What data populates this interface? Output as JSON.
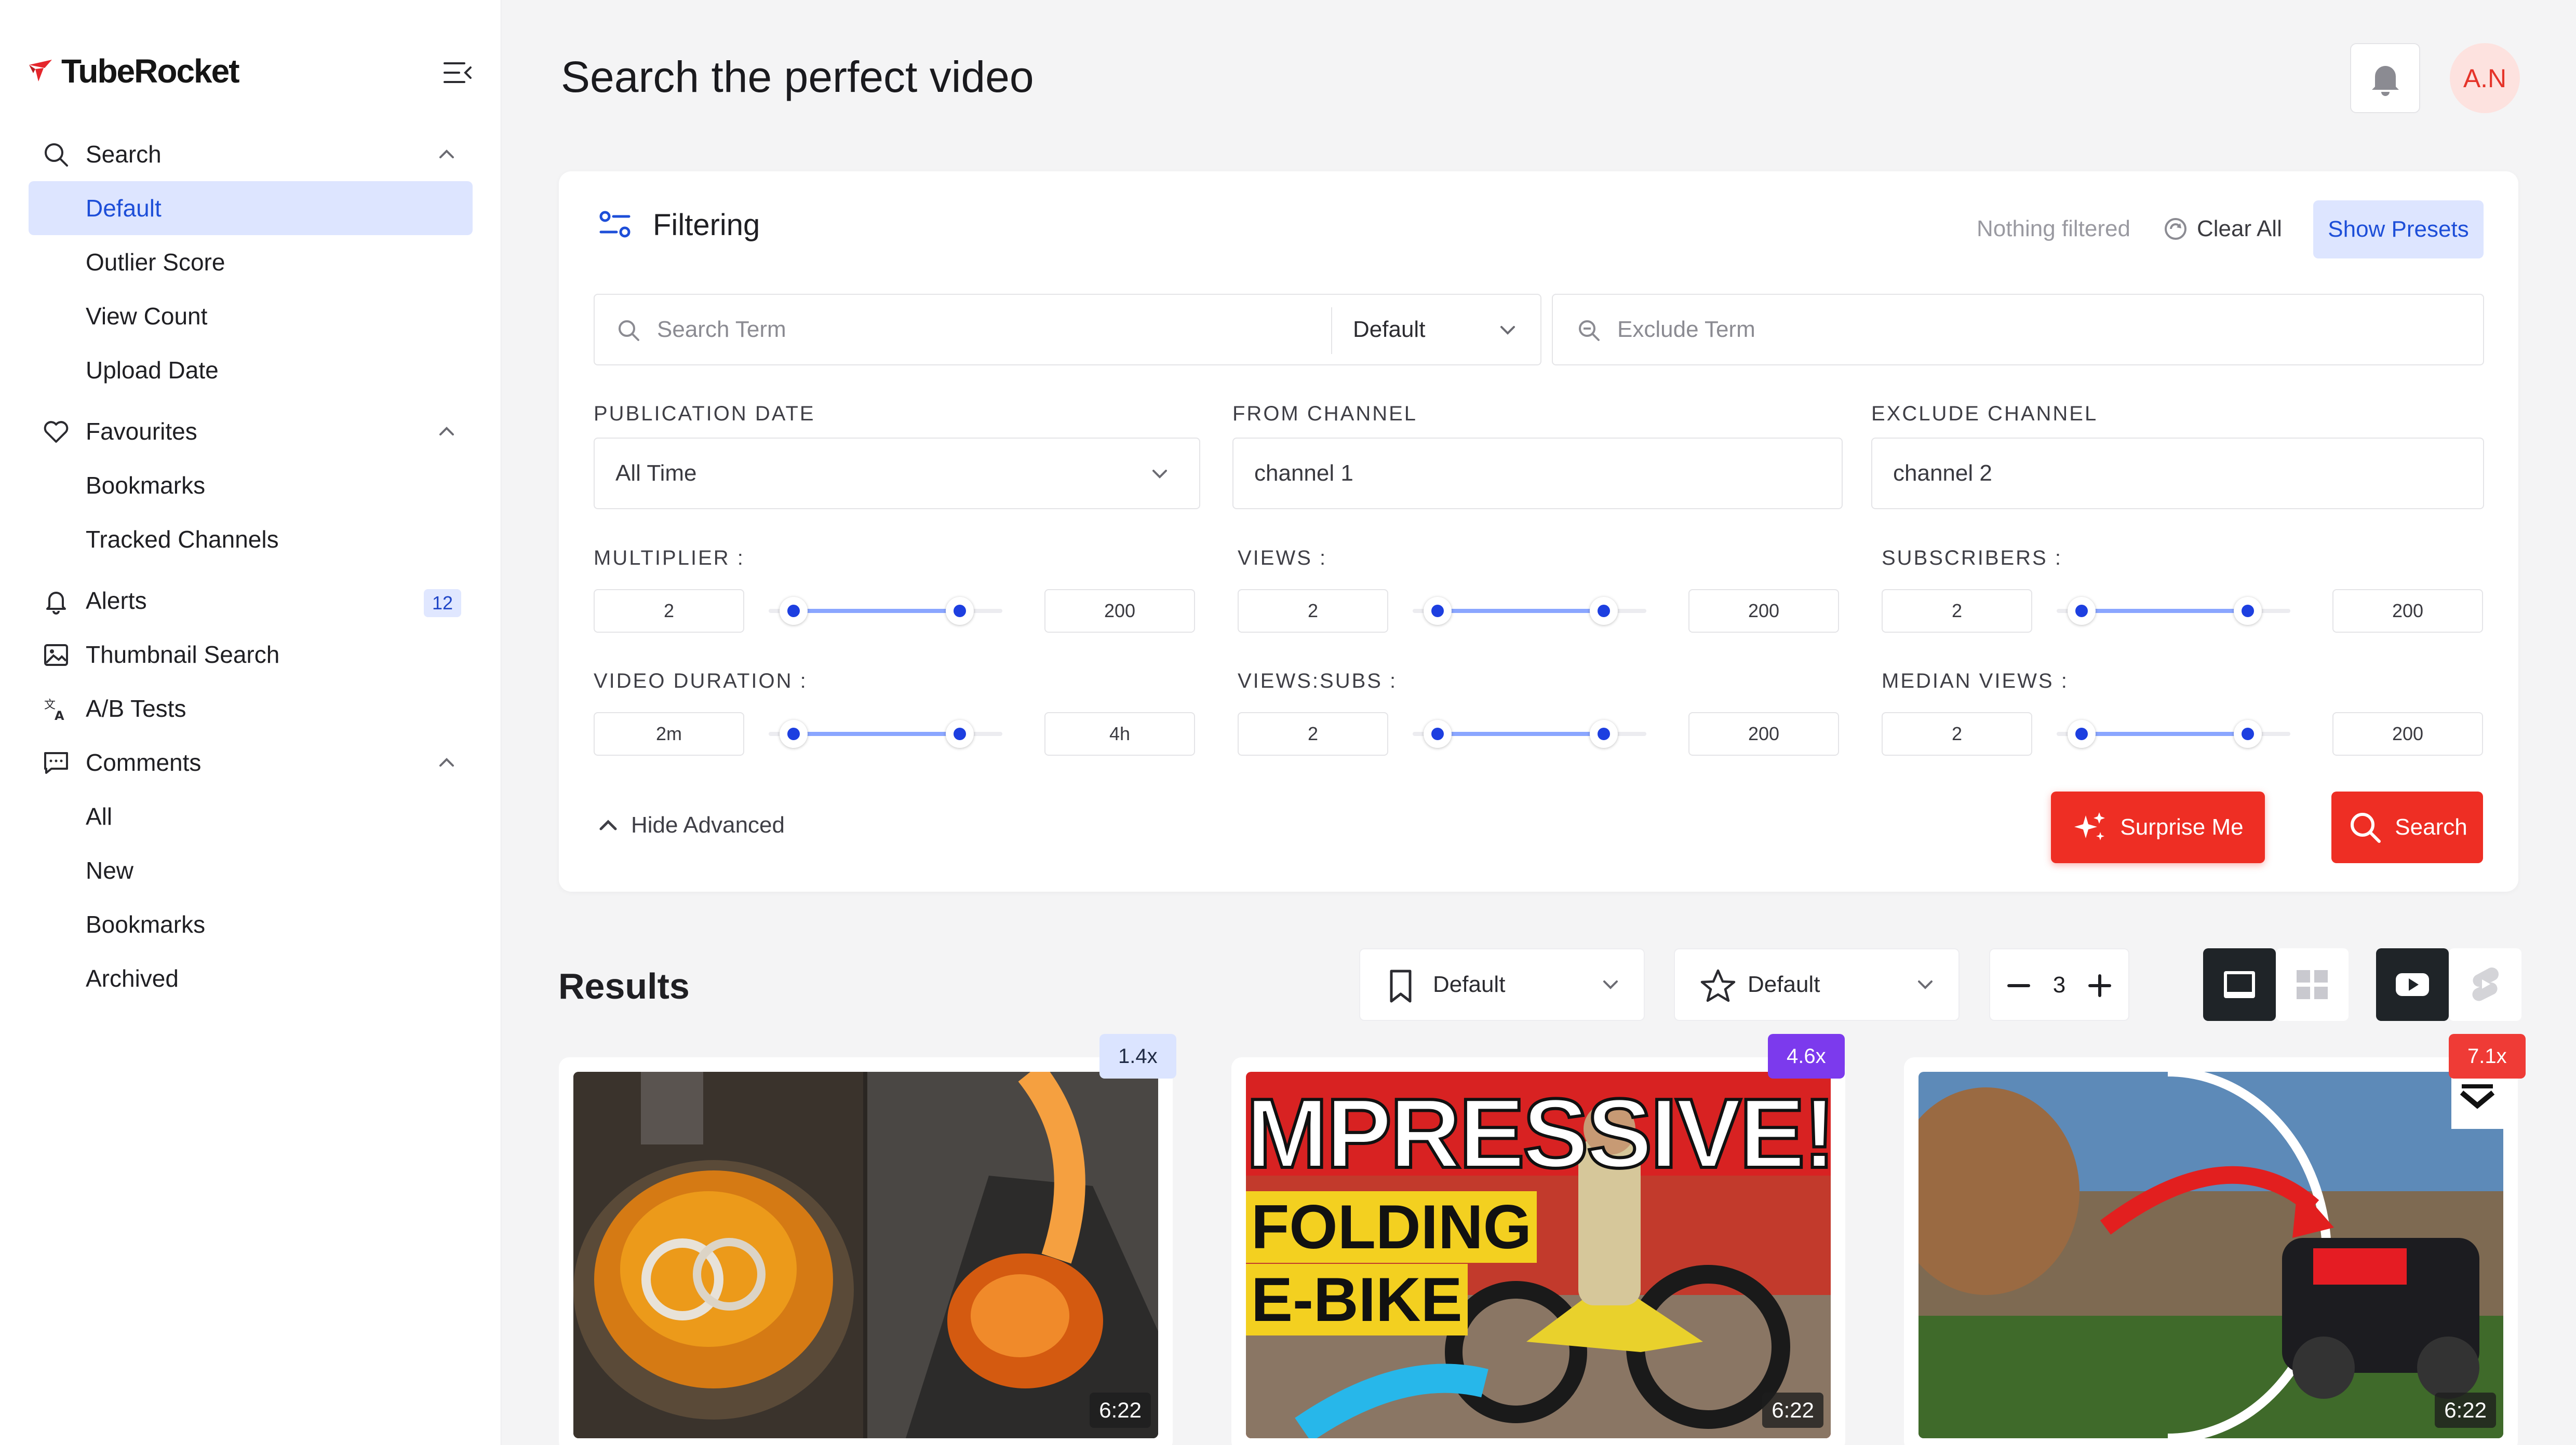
{
  "app": {
    "name": "TubeRocket"
  },
  "sidebar": {
    "sections": [
      {
        "label": "Search",
        "icon": "search-icon",
        "items": [
          "Default",
          "Outlier Score",
          "View Count",
          "Upload Date"
        ],
        "active": "Default"
      },
      {
        "label": "Favourites",
        "icon": "heart-icon",
        "items": [
          "Bookmarks",
          "Tracked Channels"
        ]
      },
      {
        "label": "Alerts",
        "icon": "bell-icon",
        "badge": "12"
      },
      {
        "label": "Thumbnail Search",
        "icon": "image-icon"
      },
      {
        "label": "A/B Tests",
        "icon": "translate-icon"
      },
      {
        "label": "Comments",
        "icon": "comment-icon",
        "items": [
          "All",
          "New",
          "Bookmarks",
          "Archived"
        ]
      }
    ]
  },
  "header": {
    "title": "Search the perfect video",
    "avatar_initials": "A.N"
  },
  "filter": {
    "title": "Filtering",
    "status": "Nothing filtered",
    "clear_all": "Clear All",
    "show_presets": "Show Presets",
    "search_term_placeholder": "Search Term",
    "search_mode": "Default",
    "exclude_term_placeholder": "Exclude Term",
    "publication_date": {
      "label": "PUBLICATION DATE",
      "value": "All Time"
    },
    "from_channel": {
      "label": "FROM CHANNEL",
      "value": "channel 1"
    },
    "exclude_channel": {
      "label": "EXCLUDE CHANNEL",
      "value": "channel 2"
    },
    "ranges": [
      {
        "label": "MULTIPLIER :",
        "min": "2",
        "max": "200"
      },
      {
        "label": "VIEWS :",
        "min": "2",
        "max": "200"
      },
      {
        "label": "SUBSCRIBERS :",
        "min": "2",
        "max": "200"
      },
      {
        "label": "VIDEO DURATION :",
        "min": "2m",
        "max": "4h"
      },
      {
        "label": "VIEWS:SUBS :",
        "min": "2",
        "max": "200"
      },
      {
        "label": "MEDIAN VIEWS :",
        "min": "2",
        "max": "200"
      }
    ],
    "hide_advanced": "Hide Advanced",
    "surprise_me": "Surprise Me",
    "search": "Search"
  },
  "results": {
    "title": "Results",
    "bookmark_filter": "Default",
    "star_filter": "Default",
    "columns": "3",
    "cards": [
      {
        "multiplier": "1.4x",
        "duration": "6:22",
        "badge_color": "#dbe4ff",
        "badge_text_color": "#1f2a44"
      },
      {
        "multiplier": "4.6x",
        "duration": "6:22",
        "badge_color": "#7c3aed",
        "badge_text_color": "#ffffff",
        "thumb_text": [
          "MPRESSIVE!",
          "FOLDING",
          "E-BIKE"
        ]
      },
      {
        "multiplier": "7.1x",
        "duration": "6:22",
        "badge_color": "#ef3b36",
        "badge_text_color": "#ffffff"
      }
    ]
  },
  "colors": {
    "accent": "#1d4ed8",
    "brand_red": "#ee2e24",
    "slider_fill": "#8aa6ff"
  }
}
